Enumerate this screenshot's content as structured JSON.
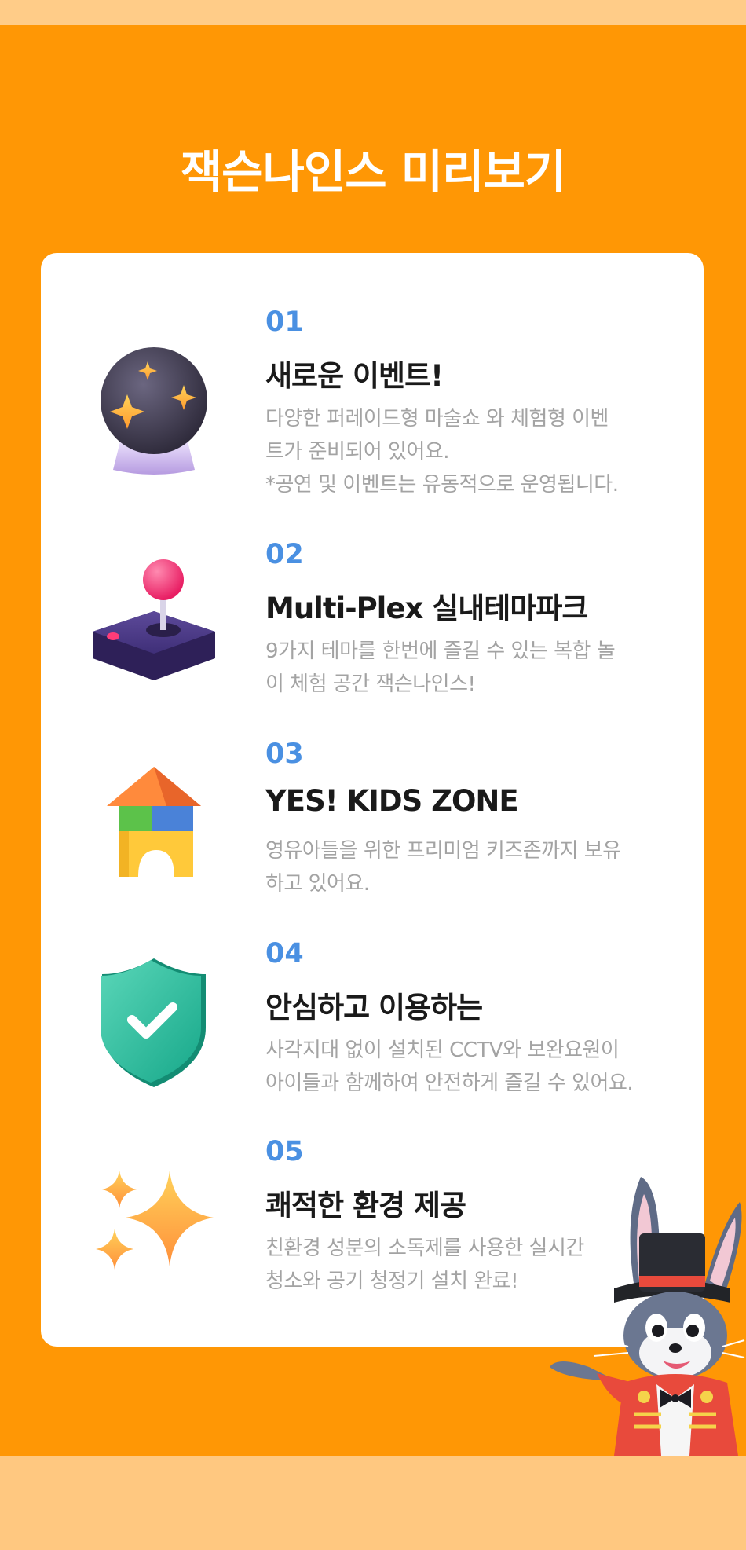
{
  "page": {
    "title": "잭슨나인스 미리보기"
  },
  "features": [
    {
      "number": "01",
      "title": "새로운 이벤트!",
      "icon": "crystal-ball-icon",
      "lines": [
        "다양한 퍼레이드형 마술쇼 와 체험형 이벤",
        "트가 준비되어 있어요.",
        "*공연 및 이벤트는 유동적으로 운영됩니다."
      ]
    },
    {
      "number": "02",
      "title": "Multi-Plex 실내테마파크",
      "icon": "joystick-icon",
      "lines": [
        "9가지 테마를 한번에 즐길 수 있는 복합 놀",
        "이 체험 공간 잭슨나인스!"
      ]
    },
    {
      "number": "03",
      "title": "YES! KIDS ZONE",
      "icon": "building-blocks-icon",
      "lines": [
        "영유아들을 위한 프리미엄 키즈존까지 보유",
        "하고 있어요."
      ]
    },
    {
      "number": "04",
      "title": "안심하고 이용하는",
      "icon": "shield-check-icon",
      "lines": [
        "사각지대 없이 설치된 CCTV와 보완요원이",
        "아이들과 함께하여 안전하게 즐길 수 있어요."
      ]
    },
    {
      "number": "05",
      "title": "쾌적한 환경 제공",
      "icon": "sparkles-icon",
      "lines": [
        "친환경 성분의 소독제를 사용한 실시간",
        "청소와 공기 청정기 설치 완료!"
      ]
    }
  ],
  "colors": {
    "orange": "#ff9705",
    "peach": "#ffcc88",
    "number_blue": "#4a90e2",
    "title_dark": "#1a1a1a",
    "desc_gray": "#a3a3a3"
  }
}
